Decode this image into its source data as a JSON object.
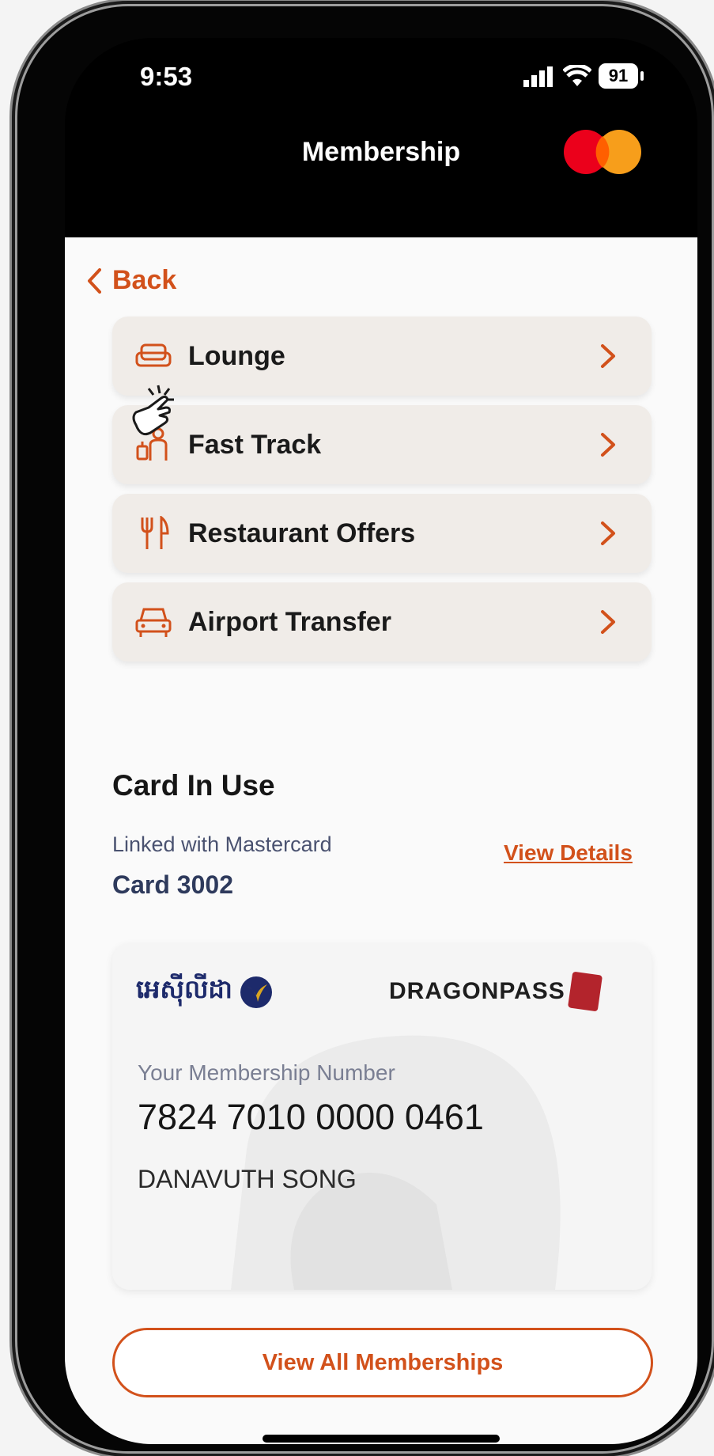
{
  "status_bar": {
    "time": "9:53",
    "battery": "91"
  },
  "header": {
    "title": "Membership"
  },
  "nav": {
    "back_label": "Back"
  },
  "menu": {
    "items": [
      {
        "label": "Lounge",
        "icon": "sofa-icon"
      },
      {
        "label": "Fast Track",
        "icon": "person-luggage-icon"
      },
      {
        "label": "Restaurant Offers",
        "icon": "fork-knife-icon"
      },
      {
        "label": "Airport Transfer",
        "icon": "car-icon"
      }
    ]
  },
  "card_in_use": {
    "title": "Card In Use",
    "linked_text": "Linked with Mastercard",
    "card_label": "Card 3002",
    "view_details": "View Details"
  },
  "membership_card": {
    "bank_logo_text": "អេស៊ីលីដា",
    "partner_logo_text": "DRAGONPASS",
    "number_label": "Your Membership Number",
    "number": "7824 7010 0000 0461",
    "holder_name": "DANAVUTH SONG"
  },
  "actions": {
    "view_all": "View All Memberships"
  },
  "colors": {
    "accent": "#d2511b",
    "header_bg": "#000000",
    "card_bg": "#f0ece8"
  }
}
